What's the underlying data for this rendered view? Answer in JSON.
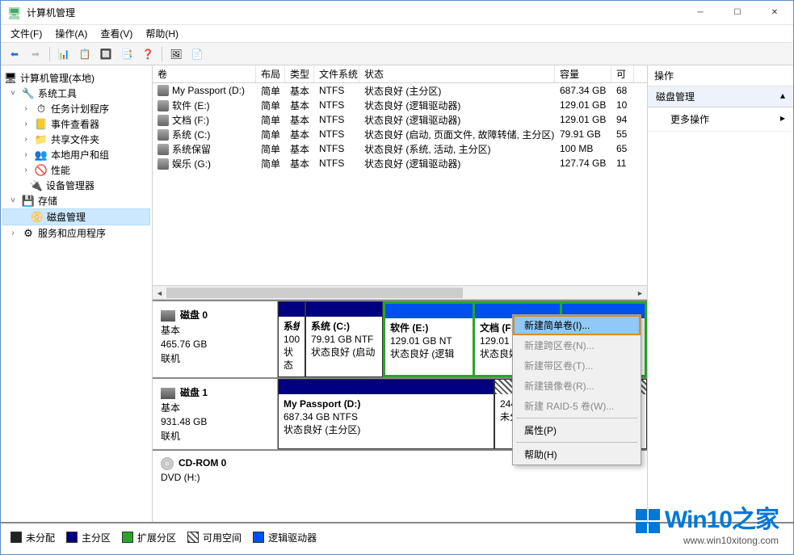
{
  "window": {
    "title": "计算机管理"
  },
  "menus": {
    "file": "文件(F)",
    "action": "操作(A)",
    "view": "查看(V)",
    "help": "帮助(H)"
  },
  "tree": {
    "root": "计算机管理(本地)",
    "systools": "系统工具",
    "sched": "任务计划程序",
    "evt": "事件查看器",
    "shared": "共享文件夹",
    "users": "本地用户和组",
    "perf": "性能",
    "devmgr": "设备管理器",
    "storage": "存储",
    "diskmgmt": "磁盘管理",
    "services": "服务和应用程序"
  },
  "vol_headers": {
    "vol": "卷",
    "layout": "布局",
    "type": "类型",
    "fs": "文件系统",
    "status": "状态",
    "cap": "容量",
    "free": "可"
  },
  "volumes": [
    {
      "name": "My Passport (D:)",
      "layout": "简单",
      "type": "基本",
      "fs": "NTFS",
      "status": "状态良好 (主分区)",
      "cap": "687.34 GB",
      "free": "68"
    },
    {
      "name": "软件 (E:)",
      "layout": "简单",
      "type": "基本",
      "fs": "NTFS",
      "status": "状态良好 (逻辑驱动器)",
      "cap": "129.01 GB",
      "free": "10"
    },
    {
      "name": "文档 (F:)",
      "layout": "简单",
      "type": "基本",
      "fs": "NTFS",
      "status": "状态良好 (逻辑驱动器)",
      "cap": "129.01 GB",
      "free": "94"
    },
    {
      "name": "系统 (C:)",
      "layout": "简单",
      "type": "基本",
      "fs": "NTFS",
      "status": "状态良好 (启动, 页面文件, 故障转储, 主分区)",
      "cap": "79.91 GB",
      "free": "55"
    },
    {
      "name": "系统保留",
      "layout": "简单",
      "type": "基本",
      "fs": "NTFS",
      "status": "状态良好 (系统, 活动, 主分区)",
      "cap": "100 MB",
      "free": "65"
    },
    {
      "name": "娱乐 (G:)",
      "layout": "简单",
      "type": "基本",
      "fs": "NTFS",
      "status": "状态良好 (逻辑驱动器)",
      "cap": "127.74 GB",
      "free": "11"
    }
  ],
  "disks": {
    "d0": {
      "name": "磁盘 0",
      "type": "基本",
      "size": "465.76 GB",
      "state": "联机"
    },
    "d0_parts": {
      "p0": {
        "name": "系统",
        "l2": "100",
        "l3": "状态"
      },
      "p1": {
        "name": "系统  (C:)",
        "l2": "79.91 GB NTF",
        "l3": "状态良好 (启动"
      },
      "p2": {
        "name": "软件  (E:)",
        "l2": "129.01 GB NT",
        "l3": "状态良好 (逻辑"
      },
      "p3": {
        "name": "文档  (F:)",
        "l2": "129.01 GB NT",
        "l3": "状态良好 (逻"
      }
    },
    "d1": {
      "name": "磁盘 1",
      "type": "基本",
      "size": "931.48 GB",
      "state": "联机"
    },
    "d1_parts": {
      "p0": {
        "name": "My Passport  (D:)",
        "l2": "687.34 GB NTFS",
        "l3": "状态良好 (主分区)"
      },
      "p1": {
        "name": "",
        "l2": "244.14 GB",
        "l3": "未分配"
      }
    },
    "cd": {
      "name": "CD-ROM 0",
      "sub": "DVD (H:)"
    }
  },
  "legend": {
    "unalloc": "未分配",
    "primary": "主分区",
    "ext": "扩展分区",
    "free": "可用空间",
    "logical": "逻辑驱动器"
  },
  "actions": {
    "header": "操作",
    "section": "磁盘管理",
    "more": "更多操作"
  },
  "ctx": {
    "simple": "新建简单卷(I)...",
    "span": "新建跨区卷(N)...",
    "stripe": "新建带区卷(T)...",
    "mirror": "新建镜像卷(R)...",
    "raid5": "新建 RAID-5 卷(W)...",
    "prop": "属性(P)",
    "help": "帮助(H)"
  },
  "watermark": {
    "brand": "Win10之家",
    "url": "www.win10xitong.com"
  }
}
